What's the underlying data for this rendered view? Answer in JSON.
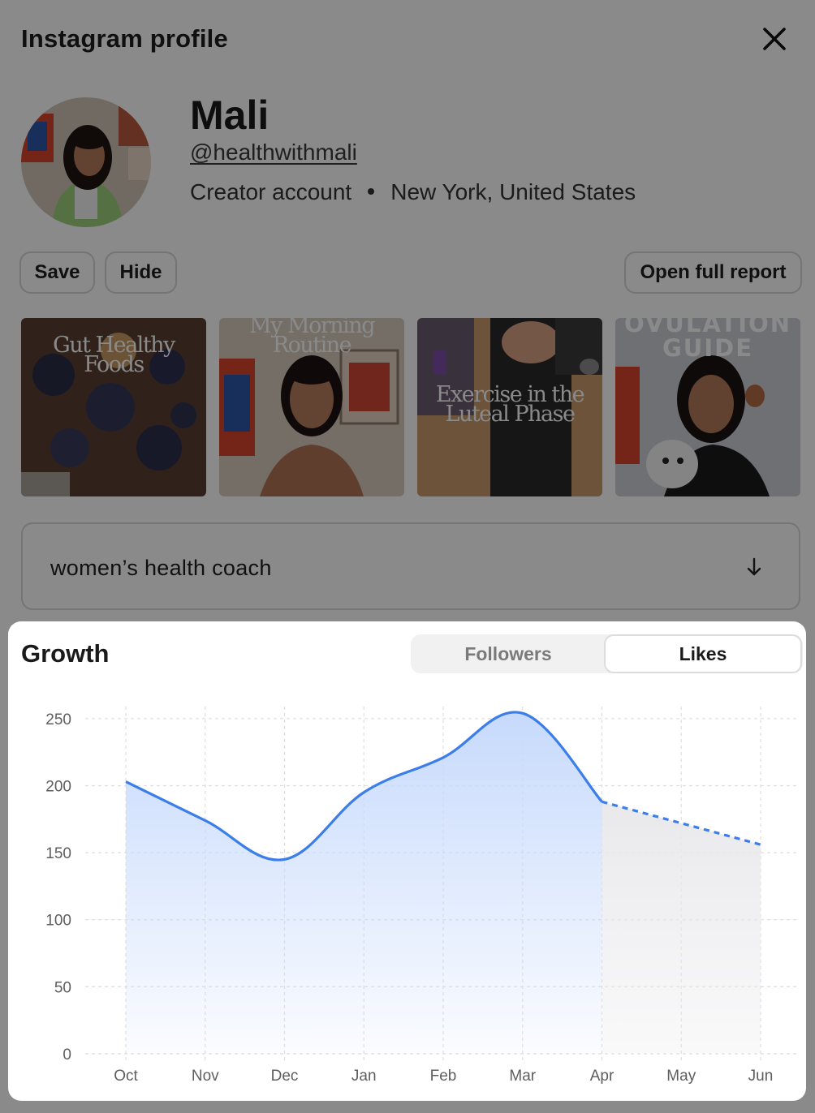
{
  "modal": {
    "title": "Instagram profile",
    "close_icon": "close-icon"
  },
  "profile": {
    "name": "Mali",
    "handle": "@healthwithmali",
    "account_type": "Creator account",
    "location": "New York, United States"
  },
  "actions": {
    "save_label": "Save",
    "hide_label": "Hide",
    "report_label": "Open full report"
  },
  "posts": [
    {
      "caption_lines": [
        "Gut Healthy",
        "Foods"
      ]
    },
    {
      "caption_lines": [
        "My Morning",
        "Routine"
      ]
    },
    {
      "caption_lines": [
        "Exercise in the",
        "Luteal Phase"
      ]
    },
    {
      "caption_lines": [
        "OVULATION",
        "GUIDE"
      ]
    }
  ],
  "bio": {
    "text": "women’s health coach",
    "expand_icon": "arrow-down-icon"
  },
  "growth": {
    "title": "Growth",
    "tabs": [
      {
        "label": "Followers",
        "active": false
      },
      {
        "label": "Likes",
        "active": true
      }
    ]
  },
  "colors": {
    "accent": "#3b7eeb",
    "area_fill": "#c7dafc",
    "projection_fill": "#e9e9ec",
    "grid": "#dedede"
  },
  "chart_data": {
    "type": "area",
    "categories": [
      "Oct",
      "Nov",
      "Dec",
      "Jan",
      "Feb",
      "Mar",
      "Apr",
      "May",
      "Jun"
    ],
    "series": [
      {
        "values": [
          203,
          174,
          145,
          195,
          221,
          254,
          188,
          null,
          null
        ],
        "style": "solid"
      },
      {
        "values": [
          null,
          null,
          null,
          null,
          null,
          null,
          188,
          172,
          156
        ],
        "style": "dashed"
      }
    ],
    "yticks": [
      0,
      50,
      100,
      150,
      200,
      250
    ],
    "ylim": [
      0,
      262
    ],
    "grid": true,
    "xlabel": "",
    "ylabel": ""
  }
}
